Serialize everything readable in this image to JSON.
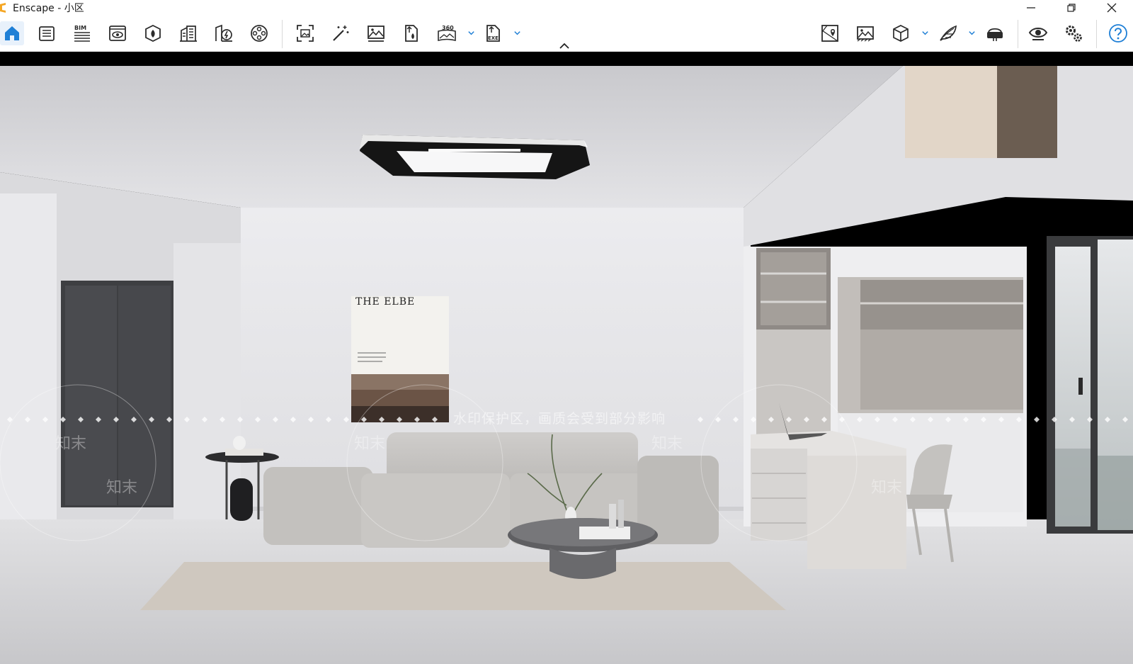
{
  "window": {
    "title": "Enscape - 小区"
  },
  "toolbar": {
    "left_icons": [
      {
        "name": "home-icon",
        "active": true
      },
      {
        "name": "document-list-icon"
      },
      {
        "name": "bim-icon",
        "label": "BIM"
      },
      {
        "name": "view-eye-icon"
      },
      {
        "name": "asset-library-icon"
      },
      {
        "name": "building-icon"
      },
      {
        "name": "live-update-icon"
      },
      {
        "name": "video-reel-icon"
      },
      {
        "name": "screenshot-icon"
      },
      {
        "name": "magic-wand-icon"
      },
      {
        "name": "image-icon"
      },
      {
        "name": "export-file-icon"
      },
      {
        "name": "panorama-360-icon",
        "label": "360"
      },
      {
        "name": "exe-export-icon",
        "label": "EXE"
      }
    ],
    "right_icons": [
      {
        "name": "map-view-icon"
      },
      {
        "name": "gallery-icon"
      },
      {
        "name": "cube-view-icon"
      },
      {
        "name": "feather-icon"
      },
      {
        "name": "vr-headset-icon"
      },
      {
        "name": "visibility-icon"
      },
      {
        "name": "settings-icon"
      },
      {
        "name": "help-icon"
      }
    ]
  },
  "viewport": {
    "poster_title": "THE ELBE",
    "watermark_text": "水印保护区，画质会受到部分影响",
    "watermark_logo": "知末"
  },
  "colors": {
    "accent": "#1e7fd6",
    "icon": "#2b2b2b",
    "wall": "#e6e6e9",
    "floor": "#d4d4d6"
  }
}
